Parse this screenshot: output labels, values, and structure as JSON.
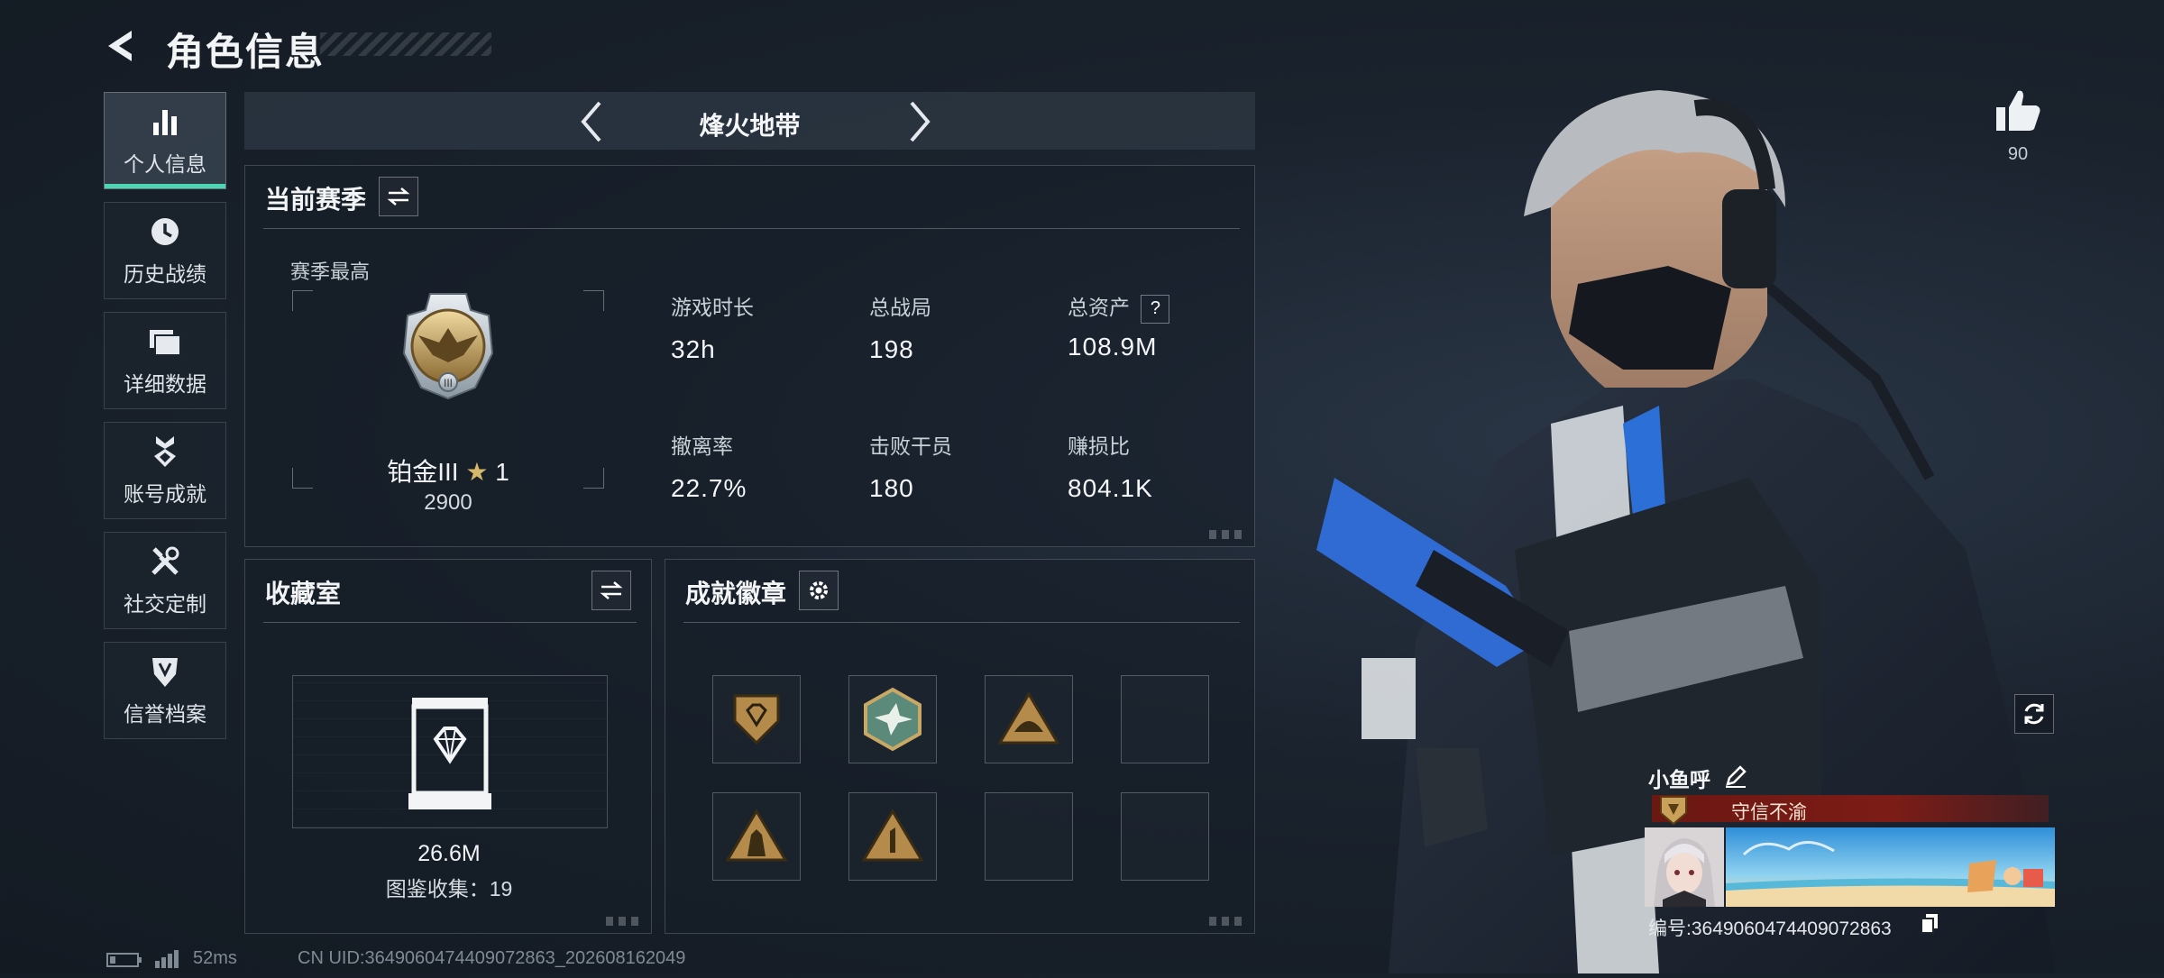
{
  "header": {
    "title": "角色信息"
  },
  "sidebar": {
    "items": [
      {
        "label": "个人信息",
        "icon": "bar-chart-icon",
        "active": true
      },
      {
        "label": "历史战绩",
        "icon": "clock-icon",
        "active": false
      },
      {
        "label": "详细数据",
        "icon": "folders-icon",
        "active": false
      },
      {
        "label": "账号成就",
        "icon": "medal-icon",
        "active": false
      },
      {
        "label": "社交定制",
        "icon": "tools-icon",
        "active": false
      },
      {
        "label": "信誉档案",
        "icon": "shield-emblem-icon",
        "active": false
      }
    ]
  },
  "mode": {
    "label": "烽火地带"
  },
  "season": {
    "title": "当前赛季",
    "best_label": "赛季最高",
    "rank_name": "铂金III",
    "rank_stars": "1",
    "rank_score": "2900",
    "stats": [
      {
        "key": "游戏时长",
        "value": "32h"
      },
      {
        "key": "总战局",
        "value": "198"
      },
      {
        "key": "总资产",
        "value": "108.9M"
      },
      {
        "key": "撤离率",
        "value": "22.7%"
      },
      {
        "key": "击败干员",
        "value": "180"
      },
      {
        "key": "赚损比",
        "value": "804.1K"
      }
    ]
  },
  "collection": {
    "title": "收藏室",
    "value": "26.6M",
    "count_text": "图鉴收集：19"
  },
  "badges": {
    "title": "成就徽章",
    "slots": [
      "shield-badge",
      "hex-bird-badge",
      "triangle-hat-badge",
      "empty",
      "triangle-soldiers-badge",
      "triangle-one-badge",
      "empty",
      "empty"
    ]
  },
  "likes": {
    "count": "90"
  },
  "player": {
    "name": "小鱼呼",
    "title": "守信不渝",
    "id_text": "编号:3649060474409072863"
  },
  "footer": {
    "ping": "52ms",
    "uid": "CN UID:3649060474409072863_202608162049"
  },
  "colors": {
    "accent": "#4dd6b3",
    "title_badge": "#7d1c16",
    "gold": "#d6b86a"
  }
}
